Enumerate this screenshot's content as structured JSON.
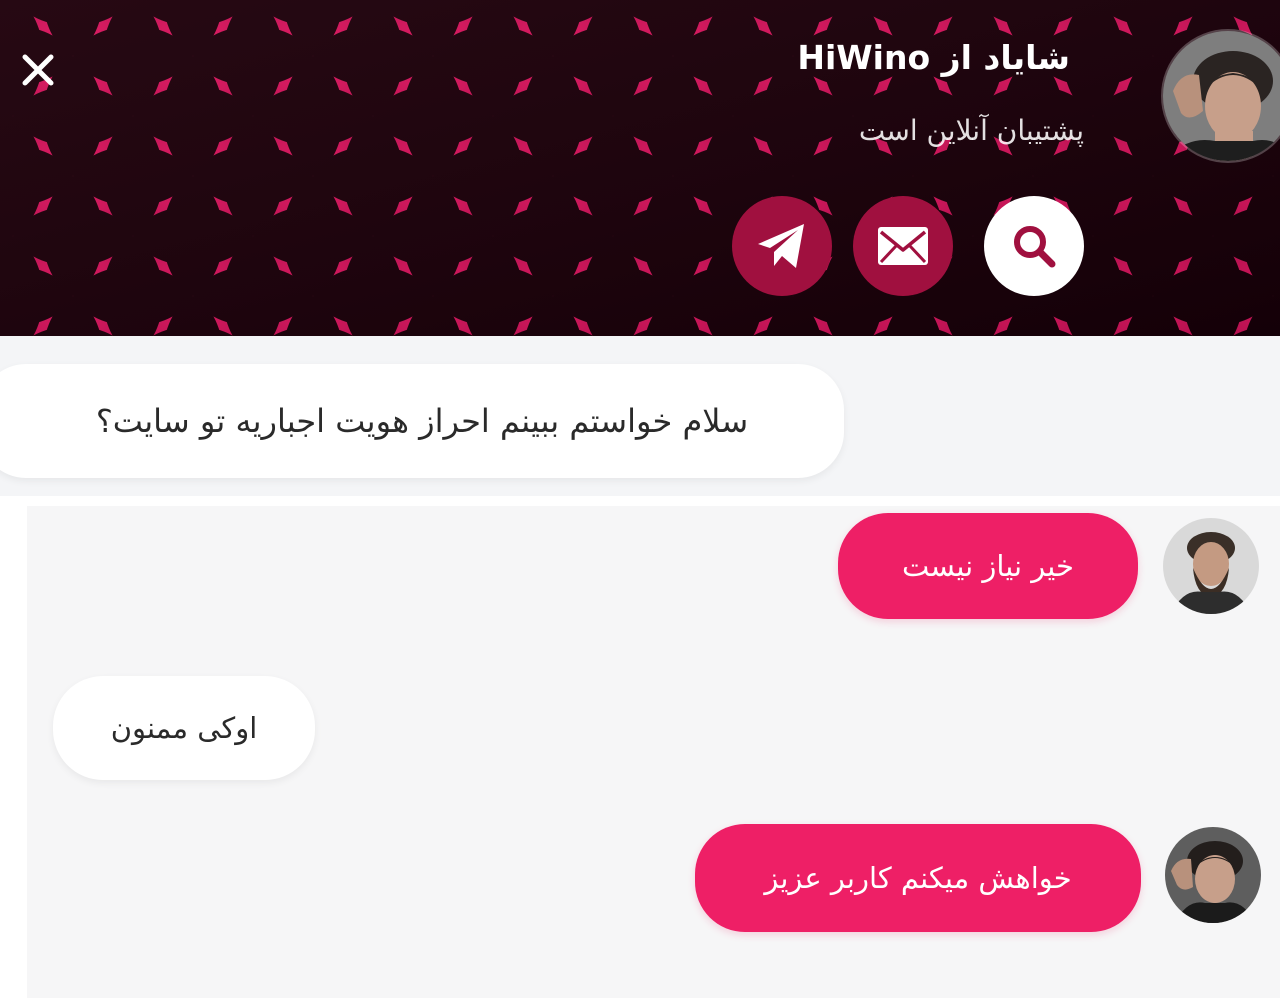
{
  "header": {
    "title": "شایاد از HiWino",
    "subtitle": "پشتیبان آنلاین است",
    "close_icon": "close-icon",
    "actions": [
      {
        "icon": "telegram-icon"
      },
      {
        "icon": "mail-icon"
      },
      {
        "icon": "search-icon"
      }
    ]
  },
  "messages": [
    {
      "from": "user",
      "text": "سلام خواستم ببینم احراز هویت اجباریه تو سایت؟"
    },
    {
      "from": "agent",
      "text": "خیر نیاز نیست"
    },
    {
      "from": "user",
      "text": "اوکی ممنون"
    },
    {
      "from": "agent",
      "text": "خواهش میکنم کاربر عزیز"
    }
  ],
  "colors": {
    "brand": "#d6175e",
    "agent_bubble": "#ee1f66",
    "pattern_dark": "#000000",
    "chat_background": "#f6f6f7"
  }
}
